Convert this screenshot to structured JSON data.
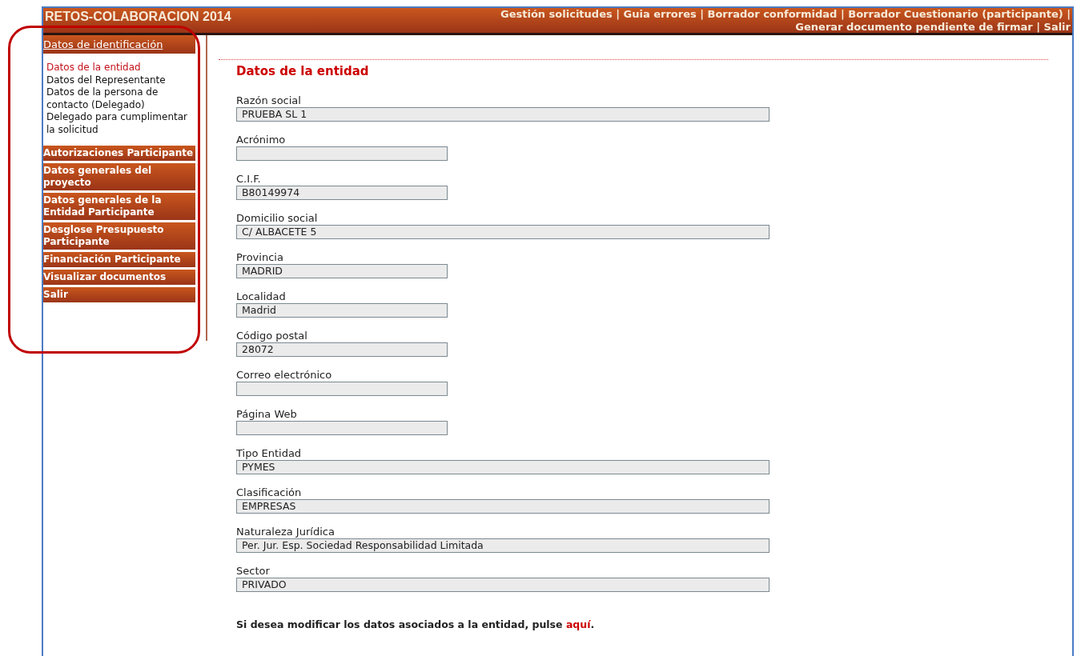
{
  "header": {
    "title": "RETOS-COLABORACION 2014",
    "separator": "|",
    "links": [
      {
        "label": "Gestión solicitudes"
      },
      {
        "label": "Guia errores"
      },
      {
        "label": "Borrador conformidad"
      },
      {
        "label": "Borrador Cuestionario (participante)"
      },
      {
        "label": "Generar documento pendiente de firmar"
      },
      {
        "label": "Salir"
      }
    ]
  },
  "sidebar": {
    "items": [
      {
        "label": "Datos de identificación",
        "selected": true,
        "children": [
          {
            "label": "Datos de la entidad",
            "selected": true
          },
          {
            "label": "Datos del Representante",
            "selected": false
          },
          {
            "label": "Datos de la persona de contacto (Delegado)",
            "selected": false
          },
          {
            "label": "Delegado para cumplimentar la solicitud",
            "selected": false
          }
        ]
      },
      {
        "label": "Autorizaciones Participante",
        "selected": false
      },
      {
        "label": "Datos generales del proyecto",
        "selected": false
      },
      {
        "label": "Datos generales de la Entidad Participante",
        "selected": false
      },
      {
        "label": "Desglose Presupuesto Participante",
        "selected": false
      },
      {
        "label": "Financiación Participante",
        "selected": false
      },
      {
        "label": "Visualizar documentos",
        "selected": false
      },
      {
        "label": "Salir",
        "selected": false
      }
    ]
  },
  "annotation": {
    "color": "#c00000"
  },
  "form": {
    "title": "Datos de la entidad",
    "fields": [
      {
        "label": "Razón social",
        "value": "PRUEBA SL 1",
        "kind": "wide"
      },
      {
        "label": "Acrónimo",
        "kind": "narrow"
      },
      {
        "label": "C.I.F.",
        "value": "B80149974",
        "kind": "narrow"
      },
      {
        "label": "Domicilio social",
        "value": "C/ ALBACETE 5",
        "kind": "wide"
      },
      {
        "label": "Provincia",
        "value": "MADRID",
        "kind": "narrow"
      },
      {
        "label": "Localidad",
        "value": "Madrid",
        "kind": "narrow"
      },
      {
        "label": "Código postal",
        "value": "28072",
        "kind": "narrow"
      },
      {
        "label": "Correo electrónico",
        "kind": "narrow"
      },
      {
        "label": "Página Web",
        "kind": "narrow"
      },
      {
        "label": "Tipo Entidad",
        "value": "PYMES",
        "kind": "wide"
      },
      {
        "label": "Clasificación",
        "value": "EMPRESAS",
        "kind": "wide"
      },
      {
        "label": "Naturaleza Jurídica",
        "value": "Per. Jur. Esp. Sociedad Responsabilidad Limitada",
        "kind": "wide"
      },
      {
        "label": "Sector",
        "value": "PRIVADO",
        "kind": "wide"
      }
    ],
    "note": {
      "text": "Si desea modificar los datos asociados a la entidad, pulse",
      "link": "aquí",
      "end": "."
    }
  }
}
